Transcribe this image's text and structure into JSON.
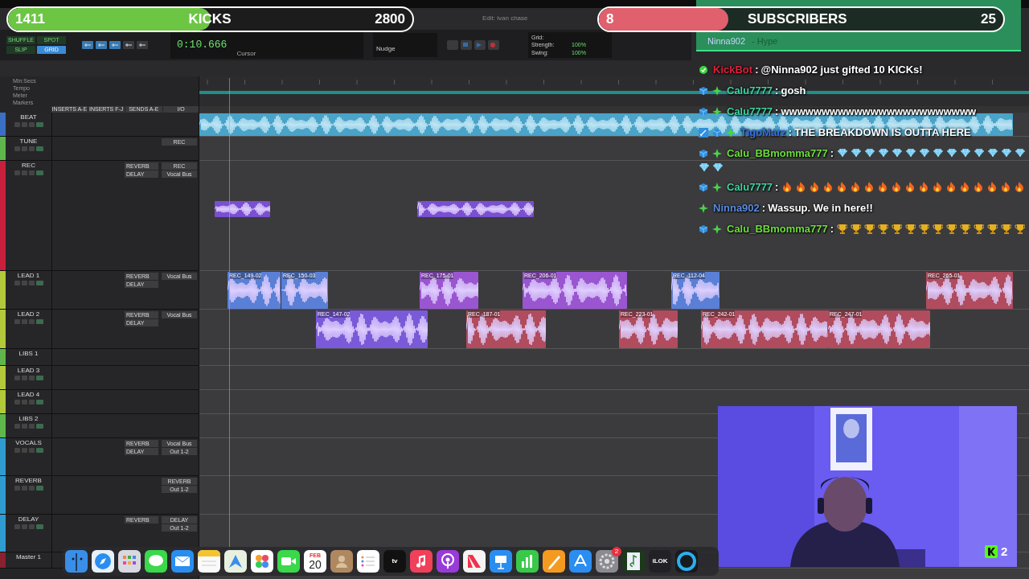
{
  "goals": [
    {
      "current": "1411",
      "label": "KICKS",
      "target": "2800",
      "level": 0.5,
      "color": "#6cc644"
    },
    {
      "current": "8",
      "label": "SUBSCRIBERS",
      "target": "25",
      "level": 0.32,
      "color": "#e0606e"
    }
  ],
  "hype": {
    "user": "Ninna902",
    "label": "- Hype"
  },
  "window_title": "Edit: ivan chase",
  "toolbar": {
    "modes": [
      {
        "label": "SHUFFLE",
        "selected": false
      },
      {
        "label": "SPOT",
        "selected": false
      },
      {
        "label": "SLIP",
        "selected": false
      },
      {
        "label": "GRID",
        "selected": true
      }
    ],
    "counter": "0:10.666",
    "cursor_label": "Cursor",
    "nudge_label": "Nudge",
    "grid_label": "Grid:",
    "strength_label": "Strength:",
    "strength": "100%",
    "swing_label": "Swing:",
    "swing": "100%"
  },
  "rulers": [
    "Min:Secs",
    "Tempo",
    "Meter",
    "Markers"
  ],
  "columns": [
    "INSERTS A-E",
    "INSERTS F-J",
    "SENDS A-E",
    "I/O"
  ],
  "tracks": [
    {
      "name": "BEAT",
      "color": "#3a6fc4",
      "clips": [
        {
          "kind": "beat",
          "color": "#4aa3c8"
        }
      ]
    },
    {
      "name": "TUNE",
      "color": "#5fb64a",
      "io": [
        "REC"
      ]
    },
    {
      "name": "REC",
      "color": "#c8203c",
      "sends": [
        "REVERB",
        "DELAY"
      ],
      "io": [
        "REC",
        "Vocal Bus"
      ],
      "clips": [
        {
          "kind": "clip",
          "color": "#7a4fd0"
        },
        {
          "kind": "clip",
          "color": "#7a4fd0"
        }
      ]
    },
    {
      "name": "LEAD 1",
      "color": "#b4c93a",
      "sends": [
        "REVERB",
        "DELAY"
      ],
      "io": [
        "Vocal Bus"
      ],
      "clips": [
        {
          "kind": "clip",
          "label": "REC_149-02",
          "color": "#5a7fd6"
        },
        {
          "kind": "clip",
          "label": "REC_150-03",
          "color": "#5a7fd6"
        },
        {
          "kind": "clip",
          "label": "REC_175-01",
          "color": "#9a55d0"
        },
        {
          "kind": "clip",
          "label": "REC_206-01",
          "color": "#9a55d0"
        },
        {
          "kind": "clip",
          "label": "REC_112-04",
          "color": "#5a7fd6"
        },
        {
          "kind": "clip",
          "label": "REC_265-01",
          "color": "#b04c5e"
        }
      ]
    },
    {
      "name": "LEAD 2",
      "color": "#b4c93a",
      "sends": [
        "REVERB",
        "DELAY"
      ],
      "io": [
        "Vocal Bus"
      ],
      "clips": [
        {
          "kind": "clip",
          "label": "REC_147-02",
          "color": "#7a5ad8"
        },
        {
          "kind": "clip",
          "label": "REC_187-01",
          "color": "#b04c5e"
        },
        {
          "kind": "clip",
          "label": "REC_223-01",
          "color": "#b04c5e"
        },
        {
          "kind": "clip",
          "label": "REC_242-01",
          "color": "#b04c5e"
        },
        {
          "kind": "clip",
          "label": "REC_247-01",
          "color": "#b04c5e"
        }
      ]
    },
    {
      "name": "LIBS 1",
      "color": "#5fb64a"
    },
    {
      "name": "LEAD 3",
      "color": "#b4c93a"
    },
    {
      "name": "LEAD 4",
      "color": "#b4c93a"
    },
    {
      "name": "LIBS 2",
      "color": "#5fb64a"
    },
    {
      "name": "VOCALS",
      "color": "#2f9ccf",
      "sends": [
        "REVERB",
        "DELAY"
      ],
      "io": [
        "Vocal Bus",
        "Out 1-2"
      ]
    },
    {
      "name": "REVERB",
      "color": "#2f9ccf",
      "io": [
        "REVERB",
        "Out 1-2"
      ]
    },
    {
      "name": "DELAY",
      "color": "#2f9ccf",
      "sends": [
        "REVERB"
      ],
      "io": [
        "DELAY",
        "Out 1-2"
      ]
    },
    {
      "name": "Master 1",
      "color": "#8a2030"
    }
  ],
  "chat": [
    {
      "user": "KickBot",
      "color": "#e0203c",
      "badges": [
        {
          "kind": "bot"
        }
      ],
      "separator": ":",
      "text": "@Ninna902 just gifted 10 KICKs!"
    },
    {
      "user": "Calu7777",
      "color": "#3fd3a0",
      "badges": [
        {
          "kind": "sub"
        },
        {
          "kind": "gifter"
        }
      ],
      "separator": ":",
      "text": "gosh"
    },
    {
      "user": "Calu7777",
      "color": "#3fd3a0",
      "badges": [
        {
          "kind": "sub"
        },
        {
          "kind": "gifter"
        }
      ],
      "separator": ":",
      "text": "wwwwwwwwwwwwwwwwwwwwwwww"
    },
    {
      "user": "TigoMarz",
      "color": "#3a6fe0",
      "badges": [
        {
          "kind": "mod"
        },
        {
          "kind": "sub"
        },
        {
          "kind": "gifter"
        }
      ],
      "separator": ":",
      "text": "THE BREAKDOWN IS OUTTA HERE"
    },
    {
      "user": "Calu_BBmomma777",
      "color": "#6cde3c",
      "badges": [
        {
          "kind": "sub"
        },
        {
          "kind": "gifter"
        }
      ],
      "separator": ":",
      "emotes": [
        {
          "kind": "diamond"
        },
        {
          "kind": "diamond"
        },
        {
          "kind": "diamond"
        },
        {
          "kind": "diamond"
        },
        {
          "kind": "diamond"
        },
        {
          "kind": "diamond"
        },
        {
          "kind": "diamond"
        },
        {
          "kind": "diamond"
        },
        {
          "kind": "diamond"
        },
        {
          "kind": "diamond"
        },
        {
          "kind": "diamond"
        },
        {
          "kind": "diamond"
        },
        {
          "kind": "diamond"
        },
        {
          "kind": "diamond"
        },
        {
          "kind": "diamond"
        },
        {
          "kind": "diamond"
        }
      ]
    },
    {
      "user": "Calu7777",
      "color": "#3fd3a0",
      "badges": [
        {
          "kind": "sub"
        },
        {
          "kind": "gifter"
        }
      ],
      "separator": ":",
      "emotes": [
        {
          "kind": "fire"
        },
        {
          "kind": "fire"
        },
        {
          "kind": "fire"
        },
        {
          "kind": "fire"
        },
        {
          "kind": "fire"
        },
        {
          "kind": "fire"
        },
        {
          "kind": "fire"
        },
        {
          "kind": "fire"
        },
        {
          "kind": "fire"
        },
        {
          "kind": "fire"
        },
        {
          "kind": "fire"
        },
        {
          "kind": "fire"
        },
        {
          "kind": "fire"
        },
        {
          "kind": "fire"
        },
        {
          "kind": "fire"
        },
        {
          "kind": "fire"
        },
        {
          "kind": "fire"
        },
        {
          "kind": "fire"
        }
      ]
    },
    {
      "user": "Ninna902",
      "color": "#5a8ae0",
      "badges": [
        {
          "kind": "gifter"
        }
      ],
      "separator": ":",
      "text": "Wassup. We in here!!"
    },
    {
      "user": "Calu_BBmomma777",
      "color": "#6cde3c",
      "badges": [
        {
          "kind": "sub"
        },
        {
          "kind": "gifter"
        }
      ],
      "separator": ":",
      "emotes": [
        {
          "kind": "trophy"
        },
        {
          "kind": "trophy"
        },
        {
          "kind": "trophy"
        },
        {
          "kind": "trophy"
        },
        {
          "kind": "trophy"
        },
        {
          "kind": "trophy"
        },
        {
          "kind": "trophy"
        },
        {
          "kind": "trophy"
        },
        {
          "kind": "trophy"
        },
        {
          "kind": "trophy"
        },
        {
          "kind": "trophy"
        },
        {
          "kind": "trophy"
        },
        {
          "kind": "trophy"
        },
        {
          "kind": "trophy"
        }
      ]
    }
  ],
  "webcam": {
    "kind": "picture",
    "viewers": "2"
  },
  "dock": [
    {
      "kind": "finder"
    },
    {
      "kind": "safari"
    },
    {
      "kind": "launchpad"
    },
    {
      "kind": "messages"
    },
    {
      "kind": "mail"
    },
    {
      "kind": "notes"
    },
    {
      "kind": "maps"
    },
    {
      "kind": "photos"
    },
    {
      "kind": "facetime"
    },
    {
      "kind": "calendar",
      "month": "FEB",
      "day": "20"
    },
    {
      "kind": "contacts"
    },
    {
      "kind": "reminders"
    },
    {
      "kind": "tv",
      "label": "tv"
    },
    {
      "kind": "music"
    },
    {
      "kind": "podcasts"
    },
    {
      "kind": "news"
    },
    {
      "kind": "keynote"
    },
    {
      "kind": "numbers"
    },
    {
      "kind": "pages"
    },
    {
      "kind": "appstore"
    },
    {
      "kind": "settings",
      "badge": "2"
    },
    {
      "kind": "notation"
    },
    {
      "kind": "ilok",
      "label": "iLOK"
    },
    {
      "kind": "ring"
    }
  ]
}
